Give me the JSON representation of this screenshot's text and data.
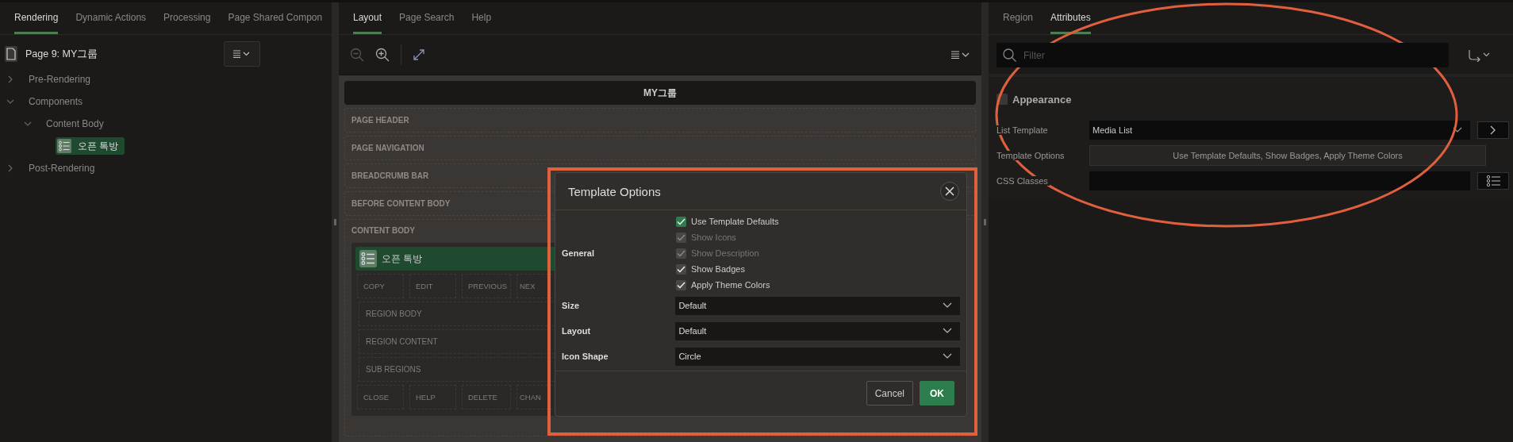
{
  "left": {
    "tabs": [
      {
        "label": "Rendering",
        "selected": true
      },
      {
        "label": "Dynamic Actions",
        "selected": false
      },
      {
        "label": "Processing",
        "selected": false
      },
      {
        "label": "Page Shared Compon",
        "selected": false
      }
    ],
    "page_title": "Page 9: MY그룹",
    "tree": [
      {
        "label": "Pre-Rendering",
        "expanded": false,
        "selected": false
      },
      {
        "label": "Components",
        "expanded": true,
        "selected": false,
        "children": [
          {
            "label": "Content Body",
            "expanded": true,
            "selected": false,
            "children": [
              {
                "label": "오픈 톡방",
                "selected": true
              }
            ]
          }
        ]
      },
      {
        "label": "Post-Rendering",
        "expanded": false,
        "selected": false
      }
    ]
  },
  "middle": {
    "tabs": [
      {
        "label": "Layout",
        "selected": true
      },
      {
        "label": "Page Search",
        "selected": false
      },
      {
        "label": "Help",
        "selected": false
      }
    ],
    "page_bar": "MY그룹",
    "sections": [
      "PAGE HEADER",
      "PAGE NAVIGATION",
      "BREADCRUMB BAR",
      "BEFORE CONTENT BODY"
    ],
    "content_body": {
      "label": "CONTENT BODY",
      "region_title": "오픈 톡방",
      "rows": [
        {
          "kind": "cells",
          "items": [
            "COPY",
            "EDIT",
            "PREVIOUS",
            "NEX"
          ]
        },
        {
          "kind": "bar",
          "label": "REGION BODY"
        },
        {
          "kind": "bar",
          "label": "REGION CONTENT"
        },
        {
          "kind": "bar",
          "label": "SUB REGIONS"
        },
        {
          "kind": "cells",
          "items": [
            "CLOSE",
            "HELP",
            "DELETE",
            "CHAN"
          ]
        }
      ]
    }
  },
  "dialog": {
    "title": "Template Options",
    "general_label": "General",
    "checkboxes": [
      {
        "label": "Use Template Defaults",
        "checked": true,
        "disabled": false,
        "kind": "master"
      },
      {
        "label": "Show Icons",
        "checked": true,
        "disabled": true,
        "kind": "option"
      },
      {
        "label": "Show Description",
        "checked": true,
        "disabled": true,
        "kind": "option"
      },
      {
        "label": "Show Badges",
        "checked": true,
        "disabled": false,
        "kind": "option"
      },
      {
        "label": "Apply Theme Colors",
        "checked": true,
        "disabled": false,
        "kind": "option"
      }
    ],
    "selects": [
      {
        "label": "Size",
        "value": "Default"
      },
      {
        "label": "Layout",
        "value": "Default"
      },
      {
        "label": "Icon Shape",
        "value": "Circle"
      }
    ],
    "buttons": [
      {
        "label": "Cancel",
        "kind": "secondary"
      },
      {
        "label": "OK",
        "kind": "primary"
      }
    ]
  },
  "right": {
    "tabs": [
      {
        "label": "Region",
        "selected": false
      },
      {
        "label": "Attributes",
        "selected": true
      }
    ],
    "filter": {
      "placeholder": "Filter"
    },
    "section": "Appearance",
    "fields": [
      {
        "label": "List Template",
        "kind": "select",
        "value": "Media List"
      },
      {
        "label": "Template Options",
        "kind": "button",
        "value": "Use Template Defaults, Show Badges, Apply Theme Colors"
      },
      {
        "label": "CSS Classes",
        "kind": "text"
      }
    ]
  }
}
